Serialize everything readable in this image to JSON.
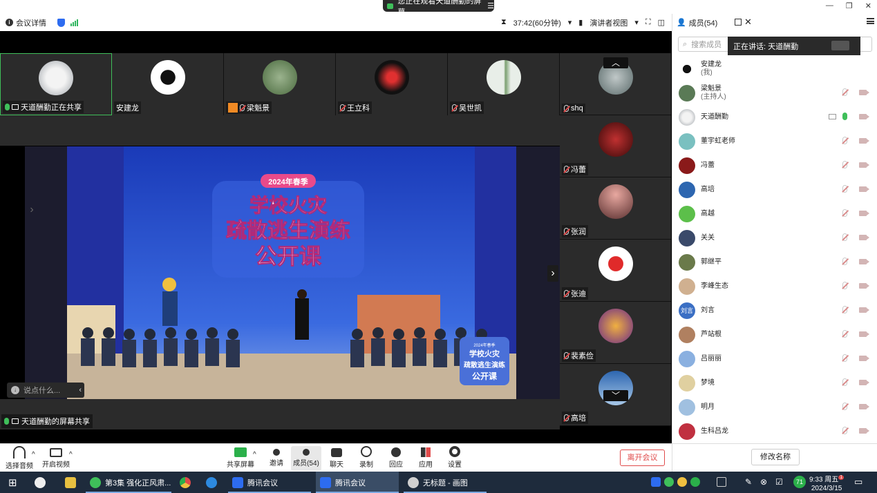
{
  "window": {
    "share_banner": "您正在观看天道酬勤的屏幕",
    "minimize": "—",
    "restore": "❐",
    "close": "✕"
  },
  "meeting_bar": {
    "details_label": "会议详情",
    "timer": "37:42(60分钟)",
    "view_mode": "演讲者视图"
  },
  "thumbnails": [
    {
      "name": "天道酬勤正在共享",
      "mic": "on-share",
      "avatar_color": "#9aa0a6"
    },
    {
      "name": "安建龙",
      "mic": "none",
      "avatar_color": "#111111"
    },
    {
      "name": "梁魁景",
      "mic": "off",
      "avatar_color": "#5a7a56",
      "host_badge": true
    },
    {
      "name": "王立科",
      "mic": "off",
      "avatar_color": "#c0191f"
    },
    {
      "name": "吴世凯",
      "mic": "off",
      "avatar_color": "#8fae96"
    }
  ],
  "right_tiles": [
    {
      "name": "shq",
      "avatar_color": "#7b8c8f"
    },
    {
      "name": "冯蕾",
      "avatar_color": "#8a1a1a"
    },
    {
      "name": "张润",
      "avatar_color": "#a9736a"
    },
    {
      "name": "张迪",
      "avatar_color": "#e23030"
    },
    {
      "name": "裴素俭",
      "avatar_color": "#e0a030"
    },
    {
      "name": "高培",
      "avatar_color": "#2d66b0"
    }
  ],
  "slide": {
    "badge": "2024年春季",
    "line1": "学校火灾",
    "line2": "疏散逃生演练",
    "line3": "公开课",
    "small_badge": "2024年春季",
    "small_line1": "学校火灾",
    "small_line2": "疏散逃生演练",
    "small_line3": "公开课"
  },
  "share_status": "天道酬勤的屏幕共享",
  "chat_placeholder": "说点什么...",
  "toolbar": {
    "audio": "选择音频",
    "video": "开启视频",
    "share": "共享屏幕",
    "invite": "邀请",
    "members": "成员(54)",
    "chat": "聊天",
    "record": "录制",
    "react": "回应",
    "apps": "应用",
    "settings": "设置",
    "leave": "离开会议"
  },
  "panel": {
    "title": "成员(54)",
    "search_placeholder": "搜索成员",
    "speaking_label": "正在讲话:",
    "speaking_name": "天道酬勤",
    "rename": "修改名称",
    "members": [
      {
        "name": "安建龙",
        "sub": "(我)",
        "color": "#222222",
        "mic": "none"
      },
      {
        "name": "梁魁景",
        "sub": "(主持人)",
        "color": "#5a7a56",
        "mic": "off"
      },
      {
        "name": "天道酬勤",
        "sub": "",
        "color": "#9aa0a6",
        "mic": "on",
        "sharing": true
      },
      {
        "name": "董宇虹老师",
        "sub": "",
        "color": "#7ac0c0",
        "mic": "off"
      },
      {
        "name": "冯蕾",
        "sub": "",
        "color": "#8a1a1a",
        "mic": "off"
      },
      {
        "name": "高培",
        "sub": "",
        "color": "#2d66b0",
        "mic": "off"
      },
      {
        "name": "高越",
        "sub": "",
        "color": "#5cbf4a",
        "mic": "off"
      },
      {
        "name": "关关",
        "sub": "",
        "color": "#3a4a6a",
        "mic": "off"
      },
      {
        "name": "郭继平",
        "sub": "",
        "color": "#6a7a4a",
        "mic": "off"
      },
      {
        "name": "李峰生态",
        "sub": "",
        "color": "#d0b090",
        "mic": "off"
      },
      {
        "name": "刘言",
        "sub": "",
        "color": "#3b6fc4",
        "mic": "off",
        "initials": "刘言"
      },
      {
        "name": "芦站根",
        "sub": "",
        "color": "#b08060",
        "mic": "off"
      },
      {
        "name": "吕丽丽",
        "sub": "",
        "color": "#8ab0e0",
        "mic": "off"
      },
      {
        "name": "梦境",
        "sub": "",
        "color": "#e0d0a0",
        "mic": "off"
      },
      {
        "name": "明月",
        "sub": "",
        "color": "#a0c0e0",
        "mic": "off"
      },
      {
        "name": "生科吕龙",
        "sub": "",
        "color": "#c03040",
        "mic": "off"
      }
    ]
  },
  "taskbar": {
    "tasks": [
      {
        "label": "第3集 强化正风肃...",
        "color": "#3fbf5a"
      },
      {
        "label": "",
        "color": "#e8a020"
      },
      {
        "label": "",
        "color": "#2d8ae0"
      },
      {
        "label": "腾讯会议",
        "color": "#2d6cf0"
      },
      {
        "label": "腾讯会议",
        "color": "#2d6cf0"
      },
      {
        "label": "无标题 - 画图",
        "color": "#d0d0d0"
      }
    ],
    "time": "9:33 周五",
    "date": "2024/3/15",
    "badge": "71",
    "notification": "1"
  }
}
